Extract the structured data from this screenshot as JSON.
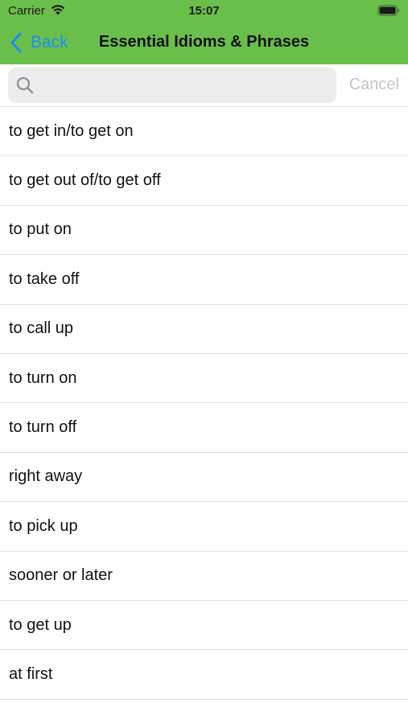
{
  "status_bar": {
    "carrier": "Carrier",
    "time": "15:07",
    "wifi_icon": "wifi-icon",
    "battery_icon": "battery-icon"
  },
  "nav": {
    "back_label": "Back",
    "title": "Essential Idioms & Phrases",
    "background_color": "#6abf4b",
    "back_color": "#1f8ef1"
  },
  "search": {
    "placeholder": "",
    "value": "",
    "cancel_label": "Cancel"
  },
  "list": {
    "items": [
      {
        "label": "to get in/to get on"
      },
      {
        "label": "to get out of/to get off"
      },
      {
        "label": "to put on"
      },
      {
        "label": "to take off"
      },
      {
        "label": "to call up"
      },
      {
        "label": "to turn on"
      },
      {
        "label": "to turn off"
      },
      {
        "label": "right away"
      },
      {
        "label": "to pick up"
      },
      {
        "label": "sooner or later"
      },
      {
        "label": "to get up"
      },
      {
        "label": "at first"
      }
    ]
  }
}
